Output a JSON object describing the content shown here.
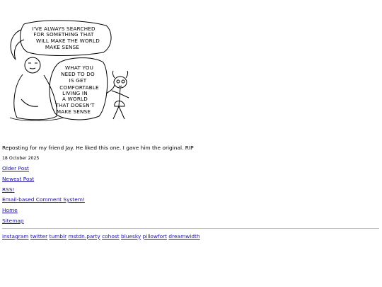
{
  "comic": {
    "bubble_left_lines": [
      "I'VE ALWAYS SEARCHED",
      "FOR SOMETHING THAT",
      "WILL MAKE THE WORLD",
      "MAKE SENSE"
    ],
    "bubble_right_lines": [
      "WHAT YOU",
      "NEED TO DO",
      "IS GET",
      "COMFORTABLE",
      "LIVING IN",
      "A WORLD",
      "THAT DOESN'T",
      "MAKE SENSE"
    ]
  },
  "post": {
    "caption": "Reposting for my friend Jay. He liked this one. I gave him the original. RIP",
    "date": "18 October 2025"
  },
  "nav": {
    "older": "Older Post",
    "newest": "Newest Post",
    "rss": "RSS!",
    "comments": "Email-based Comment System!",
    "home": "Home",
    "sitemap": "Sitemap"
  },
  "social": [
    "instagram",
    "twitter",
    "tumblr",
    "mstdn.party",
    "cohost",
    "bluesky",
    "pillowfort",
    "dreamwidth"
  ],
  "colors": {
    "link": "#1a0dab",
    "divider": "#bdbdbd",
    "ink": "#000000"
  }
}
